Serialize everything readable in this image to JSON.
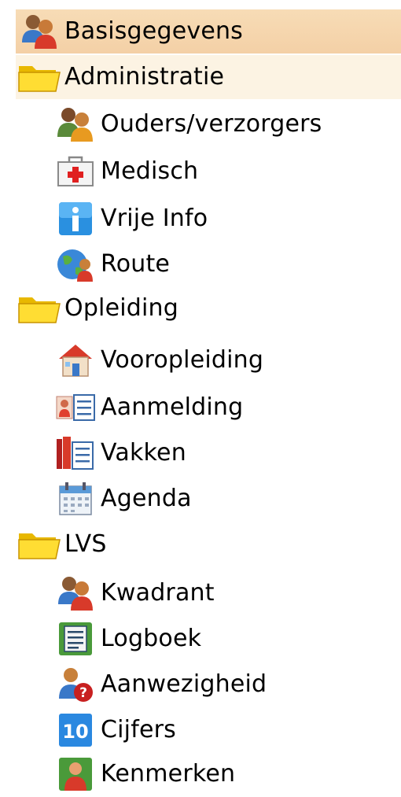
{
  "tree": {
    "items": [
      {
        "label": "Basisgegevens",
        "icon": "people-icon",
        "level": 0,
        "state": "selected"
      },
      {
        "label": "Administratie",
        "icon": "folder-icon",
        "level": 0,
        "state": "hover"
      },
      {
        "label": "Ouders/verzorgers",
        "icon": "parents-icon",
        "level": 1
      },
      {
        "label": "Medisch",
        "icon": "medical-kit-icon",
        "level": 1
      },
      {
        "label": "Vrije Info",
        "icon": "info-icon",
        "level": 1
      },
      {
        "label": "Route",
        "icon": "globe-person-icon",
        "level": 1
      },
      {
        "label": "Opleiding",
        "icon": "folder-icon",
        "level": 0
      },
      {
        "label": "Vooropleiding",
        "icon": "school-house-icon",
        "level": 1
      },
      {
        "label": "Aanmelding",
        "icon": "registration-form-icon",
        "level": 1
      },
      {
        "label": "Vakken",
        "icon": "subjects-list-icon",
        "level": 1
      },
      {
        "label": "Agenda",
        "icon": "calendar-icon",
        "level": 1
      },
      {
        "label": "LVS",
        "icon": "folder-icon",
        "level": 0
      },
      {
        "label": "Kwadrant",
        "icon": "group-icon",
        "level": 1
      },
      {
        "label": "Logboek",
        "icon": "logbook-icon",
        "level": 1
      },
      {
        "label": "Aanwezigheid",
        "icon": "attendance-icon",
        "level": 1
      },
      {
        "label": "Cijfers",
        "icon": "grades-icon",
        "level": 1
      },
      {
        "label": "Kenmerken",
        "icon": "characteristics-icon",
        "level": 1
      }
    ]
  }
}
